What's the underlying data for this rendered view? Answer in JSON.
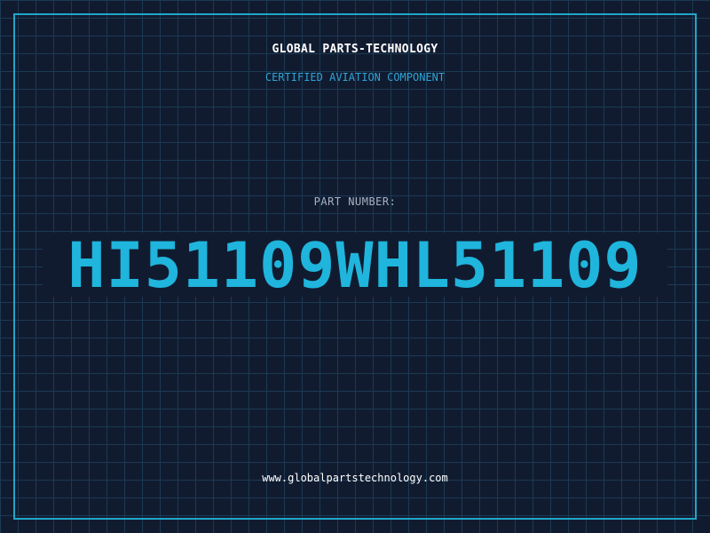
{
  "header": {
    "company_name": "GLOBAL PARTS-TECHNOLOGY",
    "tagline": "CERTIFIED AVIATION COMPONENT"
  },
  "part": {
    "label": "PART NUMBER:",
    "number": "HI51109WHL51109"
  },
  "footer": {
    "website": "www.globalpartstechnology.com"
  },
  "colors": {
    "background": "#111b30",
    "grid": "#1b3a52",
    "frame": "#21a6c9",
    "accent": "#1fb5dc",
    "tagline": "#2ea4d6"
  }
}
